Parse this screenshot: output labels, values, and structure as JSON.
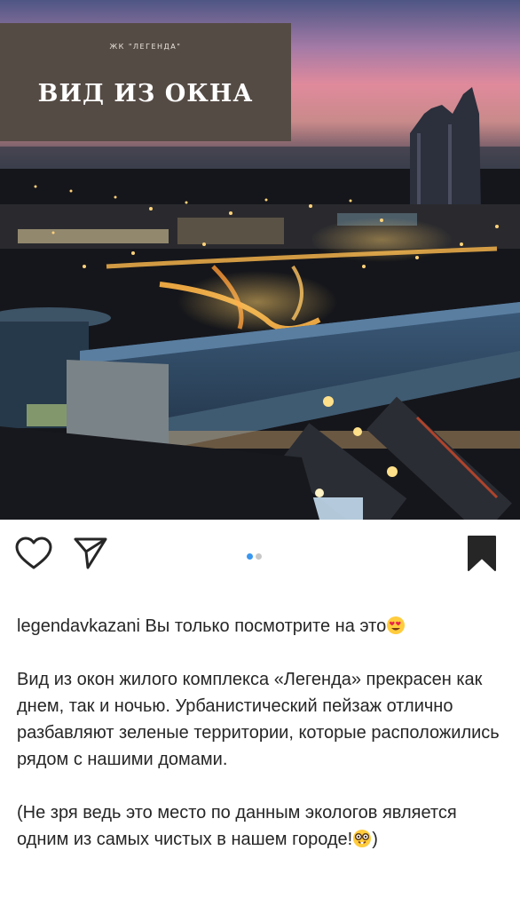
{
  "photo": {
    "overlay_small": "ЖК \"ЛЕГЕНДА\"",
    "overlay_title": "ВИД ИЗ ОКНА"
  },
  "actions": {
    "like_icon": "heart-outline-icon",
    "share_icon": "paper-plane-icon",
    "bookmark_icon": "bookmark-filled-icon",
    "carousel_pages": 2,
    "carousel_current": 1,
    "active_dot_color": "#3897f0",
    "inactive_dot_color": "#c7c7c7"
  },
  "post": {
    "username": "legendavkazani",
    "intro": " Вы только посмотрите на это",
    "paragraph1": "Вид из окон жилого комплекса «Легенда» прекрасен как днем, так и ночью. Урбанистический пейзаж отлично разбавляют зеленые территории, которые расположились рядом с нашими домами.",
    "paragraph2_a": "(Не зря ведь это место по данным экологов является одним из самых чистых в нашем городе!",
    "paragraph2_b": ")"
  }
}
